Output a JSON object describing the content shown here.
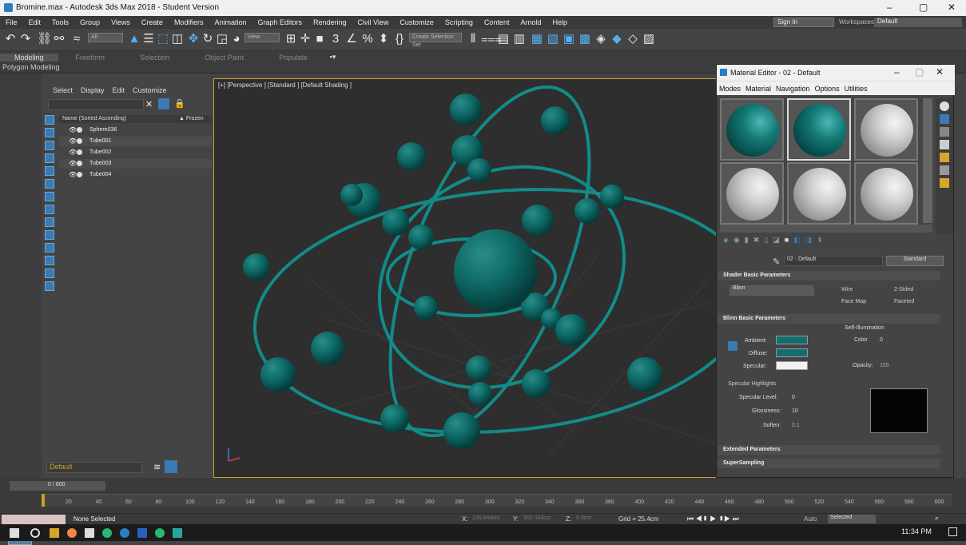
{
  "window": {
    "title": "Bromine.max - Autodesk 3ds Max 2018 - Student Version",
    "minimize": "–",
    "maximize": "▢",
    "close": "✕"
  },
  "menu": [
    "File",
    "Edit",
    "Tools",
    "Group",
    "Views",
    "Create",
    "Modifiers",
    "Animation",
    "Graph Editors",
    "Rendering",
    "Civil View",
    "Customize",
    "Scripting",
    "Content",
    "Arnold",
    "Help"
  ],
  "account": {
    "signin": "Sign In",
    "workspaces_label": "Workspaces:",
    "workspace": "Default"
  },
  "toolbar": {
    "filter": "All",
    "view": "View",
    "selection_set": "Create Selection Set"
  },
  "ribbon": {
    "tabs": [
      "Modeling",
      "Freeform",
      "Selection",
      "Object Paint",
      "Populate"
    ],
    "active": "Modeling",
    "panel": "Polygon Modeling"
  },
  "explorer": {
    "menu": [
      "Select",
      "Display",
      "Edit",
      "Customize"
    ],
    "col_name": "Name (Sorted Ascending)",
    "col_frozen": "▲ Frozen",
    "rows": [
      "Sphere036",
      "Tube001",
      "Tube002",
      "Tube003",
      "Tube004"
    ],
    "layer": "Default"
  },
  "viewport": {
    "label": "[+] [Perspective ] [Standard ] [Default Shading ]"
  },
  "material_editor": {
    "title": "Material Editor - 02 - Default",
    "menu": [
      "Modes",
      "Material",
      "Navigation",
      "Options",
      "Utilities"
    ],
    "material_name": "02 - Default",
    "material_type": "Standard",
    "rollouts": {
      "shader": "Shader Basic Parameters",
      "blinn": "Blinn Basic Parameters",
      "extended": "Extended Parameters",
      "supersampling": "SuperSampling"
    },
    "shader": {
      "type": "Blinn",
      "wire": "Wire",
      "two_sided": "2-Sided",
      "face_map": "Face Map",
      "faceted": "Faceted"
    },
    "blinn": {
      "ambient": "Ambient:",
      "diffuse": "Diffuse:",
      "specular": "Specular:",
      "self_illum": "Self-Illumination",
      "color": "Color",
      "color_val": "0",
      "opacity": "Opacity:",
      "opacity_val": "100",
      "spec_highlights": "Specular Highlights",
      "spec_level": "Specular Level:",
      "spec_level_val": "0",
      "glossiness": "Glossiness:",
      "glossiness_val": "10",
      "soften": "Soften:",
      "soften_val": "0.1"
    }
  },
  "timeline": {
    "frame": "0 / 600",
    "ticks": [
      "20",
      "40",
      "60",
      "80",
      "100",
      "120",
      "140",
      "160",
      "180",
      "200",
      "220",
      "240",
      "260",
      "280",
      "300",
      "320",
      "340",
      "360",
      "380",
      "400",
      "420",
      "440",
      "460",
      "480",
      "500",
      "520",
      "540",
      "560",
      "580",
      "600"
    ]
  },
  "status": {
    "selection": "None Selected",
    "x_label": "X:",
    "x": "235.844cm",
    "y_label": "Y:",
    "y": "302.443cm",
    "z_label": "Z:",
    "z": "0.0cm",
    "grid": "Grid = 25.4cm",
    "auto": "Auto",
    "selected": "Selected"
  },
  "taskbar": {
    "time": "11:34 PM"
  },
  "colors": {
    "teal": "#0e6b68",
    "accent": "#55b0f0",
    "highlight": "#c9a227"
  }
}
